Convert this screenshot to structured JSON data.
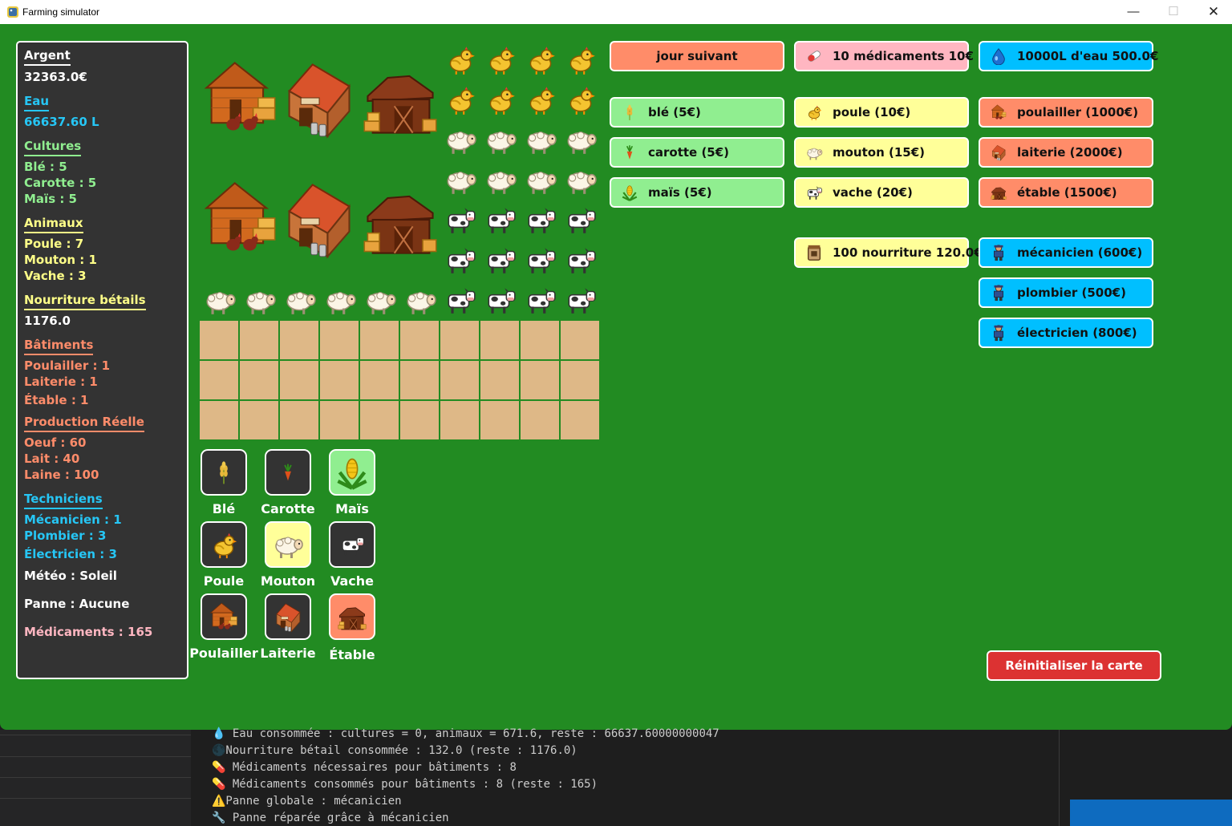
{
  "window": {
    "title": "Farming simulator",
    "min_glyph": "—",
    "max_glyph": "☐",
    "close_glyph": "✕"
  },
  "stats": {
    "argent_label": "Argent",
    "argent_value": "32363.0€",
    "eau_label": "Eau",
    "eau_value": "66637.60 L",
    "cultures_label": "Cultures",
    "ble": "Blé : 5",
    "carotte": "Carotte : 5",
    "mais": "Maïs : 5",
    "animaux_label": "Animaux",
    "poule": "Poule : 7",
    "mouton": "Mouton : 1",
    "vache": "Vache : 3",
    "nourriture_label": "Nourriture bétails",
    "nourriture_value": "1176.0",
    "batiments_label": "Bâtiments",
    "poulailler": "Poulailler : 1",
    "laiterie": "Laiterie : 1",
    "etable": "Étable : 1",
    "production_label": "Production Réelle",
    "oeuf": "Oeuf : 60",
    "lait": "Lait : 40",
    "laine": "Laine : 100",
    "techniciens_label": "Techniciens",
    "mecanicien": "Mécanicien : 1",
    "plombier": "Plombier : 3",
    "electricien": "Électricien : 3",
    "meteo": "Météo : Soleil",
    "panne": "Panne : Aucune",
    "medicaments": "Médicaments : 165"
  },
  "selector": {
    "ble": "Blé",
    "carotte": "Carotte",
    "mais": "Maïs",
    "poule": "Poule",
    "mouton": "Mouton",
    "vache": "Vache",
    "poulailler": "Poulailler",
    "laiterie": "Laiterie",
    "etable": "Étable"
  },
  "shop": {
    "jour_suivant": "jour suivant",
    "medicaments": "10 médicaments 10€",
    "eau": "10000L d'eau 500.0€",
    "ble": "blé (5€)",
    "carotte": "carotte (5€)",
    "mais": "maïs (5€)",
    "poule": "poule (10€)",
    "mouton": "mouton (15€)",
    "vache": "vache (20€)",
    "poulailler": "poulailler (1000€)",
    "laiterie": "laiterie (2000€)",
    "etable": "étable (1500€)",
    "nourriture": "100 nourriture 120.0€",
    "mecanicien": "mécanicien (600€)",
    "plombier": "plombier (500€)",
    "electricien": "électricien (800€)",
    "reset": "Réinitialiser la carte"
  },
  "colors": {
    "window_bg": "#228b22",
    "panel_bg": "#333333",
    "soil": "#deb887",
    "green_btn": "#90ee90",
    "yellow_btn": "#ffff99",
    "orange_btn": "#ff8c69",
    "blue_btn": "#00bfff",
    "pink_btn": "#ffb6c1",
    "reset_btn": "#dc3232"
  },
  "console": {
    "lines": [
      "💧 Eau consommée : cultures = 0, animaux = 671.6, reste : 66637.60000000047",
      "🌑Nourriture bétail consommée : 132.0 (reste : 1176.0)",
      "💊 Médicaments nécessaires pour bâtiments : 8",
      "💊 Médicaments consommés pour bâtiments : 8 (reste : 165)",
      "⚠️Panne globale : mécanicien",
      "🔧 Panne réparée grâce à mécanicien"
    ]
  }
}
